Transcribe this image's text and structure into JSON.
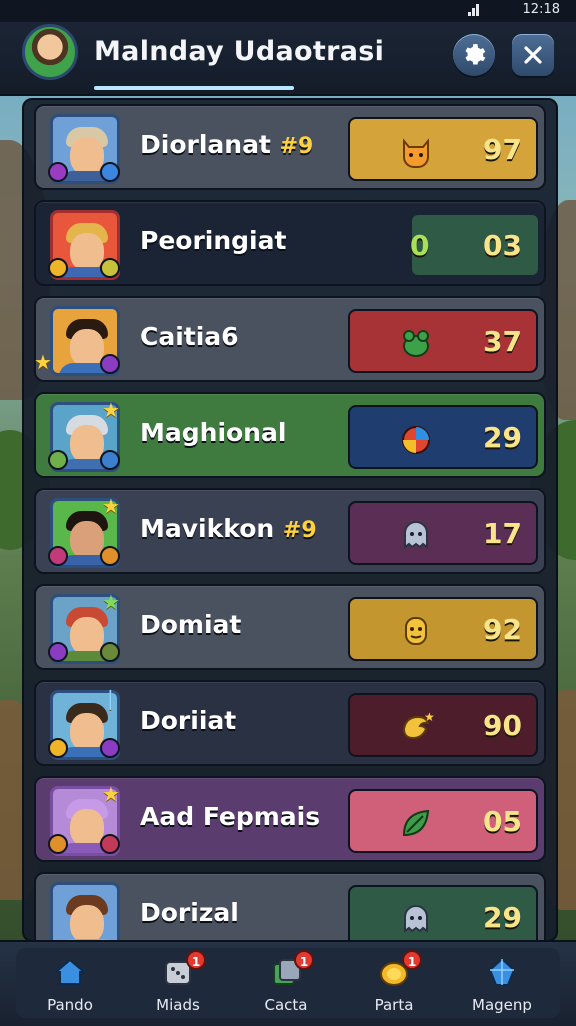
{
  "status_bar": {
    "time": "12:18"
  },
  "header": {
    "title": "Malnday Udaotrasi"
  },
  "rows": [
    {
      "name": "Diorlanat",
      "tag": "#9",
      "score": "97",
      "row_color": "#4a5260",
      "box_color": "#d4a339",
      "icon": "cat-pet-icon"
    },
    {
      "name": "Peoringiat",
      "tag": "",
      "score_left": "0",
      "score": "03",
      "row_color": "#1b2435",
      "box_color": "#2e5a46",
      "icon": ""
    },
    {
      "name": "Caitia6",
      "tag": "",
      "score": "37",
      "row_color": "#4a5260",
      "box_color": "#a83337",
      "icon": "frog-pet-icon"
    },
    {
      "name": "Maghional",
      "tag": "",
      "score": "29",
      "row_color": "#3f7a3f",
      "box_color": "#1f3d6e",
      "icon": "orb-icon"
    },
    {
      "name": "Mavikkon",
      "tag": "#9",
      "score": "17",
      "row_color": "#3a4152",
      "box_color": "#5b2e55",
      "icon": "ghost-pet-icon"
    },
    {
      "name": "Domiat",
      "tag": "",
      "score": "92",
      "row_color": "#4a5260",
      "box_color": "#c4962f",
      "icon": "mask-icon"
    },
    {
      "name": "Doriiat",
      "tag": "",
      "score": "90",
      "row_color": "#2a3142",
      "box_color": "#4e1d2c",
      "icon": "bird-pet-icon"
    },
    {
      "name": "Aad Fepmais",
      "tag": "",
      "score": "05",
      "row_color": "#5a3d6e",
      "box_color": "#d0607a",
      "icon": "leaf-icon"
    },
    {
      "name": "Dorizal",
      "tag": "",
      "score": "29",
      "row_color": "#4a5260",
      "box_color": "#2e5a46",
      "icon": "ghost-pet-icon"
    }
  ],
  "tabs": [
    {
      "label": "Pando",
      "icon": "home-icon",
      "badge": ""
    },
    {
      "label": "Miads",
      "icon": "dice-icon",
      "badge": "1"
    },
    {
      "label": "Cacta",
      "icon": "cards-icon",
      "badge": "1"
    },
    {
      "label": "Parta",
      "icon": "coin-icon",
      "badge": "1"
    },
    {
      "label": "Magenp",
      "icon": "crystal-icon",
      "badge": ""
    }
  ],
  "colors": {
    "accent": "#f8e58a",
    "header": "#1b2535",
    "panel": "#151d2b"
  }
}
